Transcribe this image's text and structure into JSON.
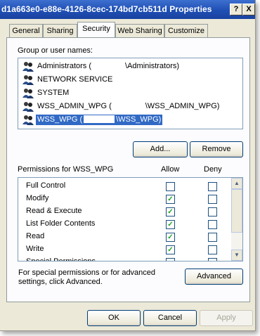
{
  "window": {
    "title": "d1a663e0-e88e-4126-8cec-174bd7cb511d Properties",
    "help_label": "?",
    "close_label": "X"
  },
  "tabs": [
    {
      "label": "General"
    },
    {
      "label": "Sharing"
    },
    {
      "label": "Security"
    },
    {
      "label": "Web Sharing"
    },
    {
      "label": "Customize"
    }
  ],
  "groups": {
    "label": "Group or user names:",
    "items": [
      {
        "pre": "Administrators (",
        "post": "\\Administrators)"
      },
      {
        "pre": "NETWORK SERVICE",
        "post": ""
      },
      {
        "pre": "SYSTEM",
        "post": ""
      },
      {
        "pre": "WSS_ADMIN_WPG (",
        "post": "\\WSS_ADMIN_WPG)"
      },
      {
        "pre": "WSS_WPG (",
        "post": "\\WSS_WPG)"
      }
    ],
    "selected_index": 4
  },
  "buttons": {
    "add": "Add...",
    "remove": "Remove",
    "advanced": "Advanced",
    "ok": "OK",
    "cancel": "Cancel",
    "apply": "Apply"
  },
  "permissions": {
    "header": "Permissions for WSS_WPG",
    "allow_header": "Allow",
    "deny_header": "Deny",
    "rows": [
      {
        "name": "Full Control",
        "allow": false,
        "deny": false
      },
      {
        "name": "Modify",
        "allow": true,
        "deny": false
      },
      {
        "name": "Read & Execute",
        "allow": true,
        "deny": false
      },
      {
        "name": "List Folder Contents",
        "allow": true,
        "deny": false
      },
      {
        "name": "Read",
        "allow": true,
        "deny": false
      },
      {
        "name": "Write",
        "allow": true,
        "deny": false
      },
      {
        "name": "Special Permissions",
        "allow": false,
        "deny": false
      }
    ]
  },
  "advanced_text": "For special permissions or for advanced settings, click Advanced.",
  "colors": {
    "selection": "#316ac5",
    "titlebar": "#1f4fb4",
    "check": "#21a121"
  }
}
